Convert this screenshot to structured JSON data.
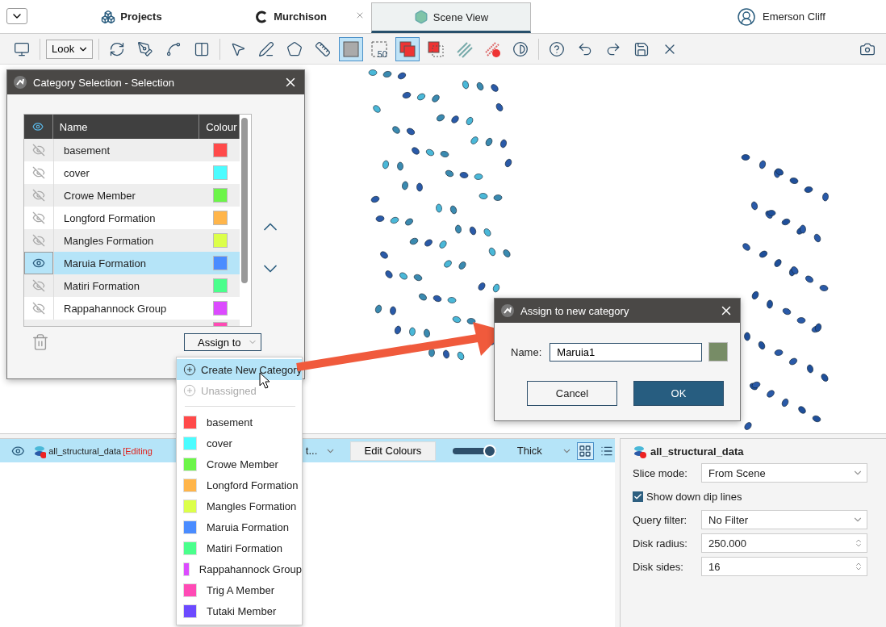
{
  "tabs_bar": {
    "tabs": [
      {
        "label": "Projects",
        "kind": "projects",
        "selected": false,
        "closable": false
      },
      {
        "label": "Murchison",
        "kind": "project",
        "selected": false,
        "closable": true
      },
      {
        "label": "Scene View",
        "kind": "scene",
        "selected": true,
        "closable": false
      }
    ],
    "user": "Emerson Cliff"
  },
  "toolbar": {
    "tools": [
      {
        "kind": "monitor-trash",
        "active": false
      },
      {
        "kind": "separator"
      },
      {
        "kind": "select",
        "label": "Look"
      },
      {
        "kind": "separator"
      },
      {
        "kind": "rotate",
        "active": false
      },
      {
        "kind": "pen",
        "active": false
      },
      {
        "kind": "polygon",
        "active": false
      },
      {
        "kind": "split",
        "active": false
      },
      {
        "kind": "separator"
      },
      {
        "kind": "pointer",
        "active": false
      },
      {
        "kind": "pen-line",
        "active": false
      },
      {
        "kind": "polygon-edit",
        "active": false
      },
      {
        "kind": "ruler",
        "active": false
      },
      {
        "kind": "square",
        "active": true
      },
      {
        "kind": "scale",
        "label": "50",
        "active": false
      },
      {
        "kind": "red-squares",
        "active": true
      },
      {
        "kind": "red-dashed",
        "active": false
      },
      {
        "kind": "hatch",
        "active": false
      },
      {
        "kind": "hatch-x",
        "active": false
      },
      {
        "kind": "contrast",
        "active": false
      },
      {
        "kind": "separator"
      },
      {
        "kind": "help",
        "active": false
      },
      {
        "kind": "undo",
        "active": false
      },
      {
        "kind": "redo",
        "active": false
      },
      {
        "kind": "save",
        "active": false
      },
      {
        "kind": "close",
        "active": false
      },
      {
        "kind": "spacer"
      },
      {
        "kind": "camera",
        "active": false
      }
    ]
  },
  "category_dialog": {
    "title": "Category Selection - Selection",
    "columns": [
      "Name",
      "Colour"
    ],
    "rows": [
      {
        "name": "basement",
        "color": "#ff4a4a",
        "visible": false,
        "selected": false
      },
      {
        "name": "cover",
        "color": "#4bfcff",
        "visible": false,
        "selected": false
      },
      {
        "name": "Crowe Member",
        "color": "#6cf549",
        "visible": false,
        "selected": false
      },
      {
        "name": "Longford Formation",
        "color": "#ffb54a",
        "visible": false,
        "selected": false
      },
      {
        "name": "Mangles Formation",
        "color": "#dcff4a",
        "visible": false,
        "selected": false
      },
      {
        "name": "Maruia Formation",
        "color": "#4a8cff",
        "visible": true,
        "selected": true
      },
      {
        "name": "Matiri Formation",
        "color": "#4aff8c",
        "visible": false,
        "selected": false
      },
      {
        "name": "Rappahannock Group",
        "color": "#dc4aff",
        "visible": false,
        "selected": false
      }
    ],
    "partial_row": {
      "color": "#ff4ab5"
    },
    "assign_button": "Assign to"
  },
  "assign_menu": {
    "actions": [
      {
        "label": "Create New Category",
        "disabled": false,
        "selected": true
      },
      {
        "label": "Unassigned",
        "disabled": true,
        "selected": false
      }
    ],
    "categories": [
      {
        "label": "basement",
        "color": "#ff4a4a"
      },
      {
        "label": "cover",
        "color": "#4bfcff"
      },
      {
        "label": "Crowe Member",
        "color": "#6cf549"
      },
      {
        "label": "Longford Formation",
        "color": "#ffb54a"
      },
      {
        "label": "Mangles Formation",
        "color": "#dcff4a"
      },
      {
        "label": "Maruia Formation",
        "color": "#4a8cff"
      },
      {
        "label": "Matiri Formation",
        "color": "#4aff8c"
      },
      {
        "label": "Rappahannock Group",
        "color": "#dc4aff"
      },
      {
        "label": "Trig A Member",
        "color": "#ff4ab5"
      },
      {
        "label": "Tutaki Member",
        "color": "#6c4aff"
      }
    ]
  },
  "assign_dialog": {
    "title": "Assign to new category",
    "name_label": "Name:",
    "name_value": "Maruia1",
    "color": "#778c66",
    "cancel": "Cancel",
    "ok": "OK"
  },
  "layer_row": {
    "visible": true,
    "name": "all_structural_data",
    "status": "[Editing",
    "dropdown_tail": "t...",
    "edit_button": "Edit Colours",
    "thickness": {
      "level": 1,
      "label": "Thick"
    }
  },
  "properties": {
    "title": "all_structural_data",
    "fields": [
      {
        "kind": "select",
        "label": "Slice mode:",
        "value": "From Scene"
      },
      {
        "kind": "checkbox",
        "label": "Show down dip lines",
        "checked": true
      },
      {
        "kind": "select",
        "label": "Query filter:",
        "value": "No Filter"
      },
      {
        "kind": "spinner",
        "label": "Disk radius:",
        "value": "250.000"
      },
      {
        "kind": "spinner",
        "label": "Disk sides:",
        "value": "16"
      }
    ]
  }
}
